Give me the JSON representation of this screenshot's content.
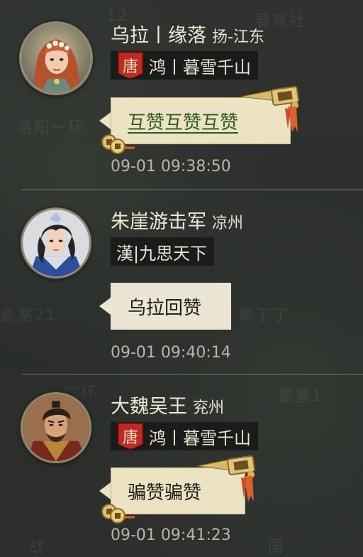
{
  "messages": [
    {
      "name": "乌拉丨缘落",
      "region": "扬-江东",
      "badge": "唐",
      "alliance": "鸿丨暮雪千山",
      "text": "互赞互赞互赞",
      "time": "09-01 09:38:50",
      "avatar_icon": "female-general-portrait-icon"
    },
    {
      "name": "朱崖游击军",
      "region": "凉州",
      "alliance": "漢|九思天下",
      "text": "乌拉回赞",
      "time": "09-01 09:40:14",
      "avatar_icon": "young-general-portrait-icon"
    },
    {
      "name": "大魏吴王",
      "region": "兖州",
      "badge": "唐",
      "alliance": "鸿丨暮雪千山",
      "text": "骗赞骗赞",
      "time": "09-01 09:41:23",
      "avatar_icon": "bearded-general-portrait-icon"
    }
  ],
  "background_text": [
    "洛阳一环",
    "12",
    "要塞21",
    "单丁丁",
    "二环",
    "要塞1",
    "战",
    "国",
    "要寒社"
  ],
  "colors": {
    "bubble_plain": "#ebe6d4",
    "bubble_gold": "#ece3c2",
    "badge_red": "#c02a22",
    "link_green": "#2d5a27"
  }
}
